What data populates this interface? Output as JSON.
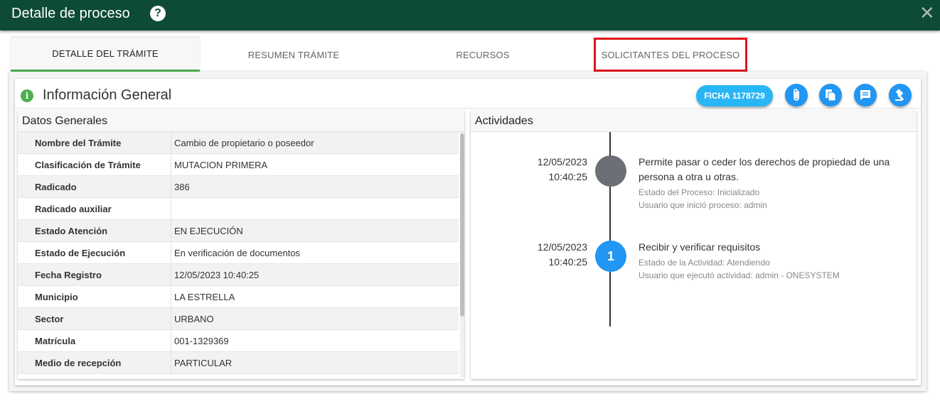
{
  "window": {
    "title": "Detalle de proceso",
    "help_icon": "help-circle-icon",
    "close_icon": "close-icon"
  },
  "tabs": [
    {
      "label": "DETALLE DEL TRÁMITE",
      "active": true
    },
    {
      "label": "RESUMEN TRÁMITE",
      "active": false
    },
    {
      "label": "RECURSOS",
      "active": false
    },
    {
      "label": "SOLICITANTES DEL PROCESO",
      "active": false,
      "highlighted": true
    }
  ],
  "card": {
    "title": "Información General",
    "info_icon": "info-icon",
    "ficha_label": "FICHA 1178729",
    "actions": [
      "attachment-icon",
      "copy-icon",
      "comment-icon",
      "gavel-icon"
    ]
  },
  "datos": {
    "title": "Datos Generales",
    "rows": [
      {
        "key": "Nombre del Trámite",
        "value": "Cambio de propietario o poseedor"
      },
      {
        "key": "Clasificación de Trámite",
        "value": "MUTACION PRIMERA"
      },
      {
        "key": "Radicado",
        "value": "386"
      },
      {
        "key": "Radicado auxiliar",
        "value": ""
      },
      {
        "key": "Estado Atención",
        "value": "EN EJECUCIÓN"
      },
      {
        "key": "Estado de Ejecución",
        "value": "En verificación de documentos"
      },
      {
        "key": "Fecha Registro",
        "value": "12/05/2023 10:40:25"
      },
      {
        "key": "Municipio",
        "value": "LA ESTRELLA"
      },
      {
        "key": "Sector",
        "value": "URBANO"
      },
      {
        "key": "Matrícula",
        "value": "001-1329369"
      },
      {
        "key": "Medio de recepción",
        "value": "PARTICULAR"
      }
    ]
  },
  "actividades": {
    "title": "Actividades",
    "items": [
      {
        "date": "12/05/2023",
        "time": "10:40:25",
        "marker": "",
        "marker_color": "#6c6f75",
        "title": "Permite pasar o ceder los derechos de propiedad de una persona a otra u otras.",
        "meta1": "Estado del Proceso: Inicializado",
        "meta2": "Usuario que inició proceso: admin"
      },
      {
        "date": "12/05/2023",
        "time": "10:40:25",
        "marker": "1",
        "marker_color": "#2196f3",
        "title": "Recibir y verificar requisitos",
        "meta1": "Estado de la Actividad: Atendiendo",
        "meta2": "Usuario que ejecutó actividad: admin - ONESYSTEM"
      }
    ]
  }
}
